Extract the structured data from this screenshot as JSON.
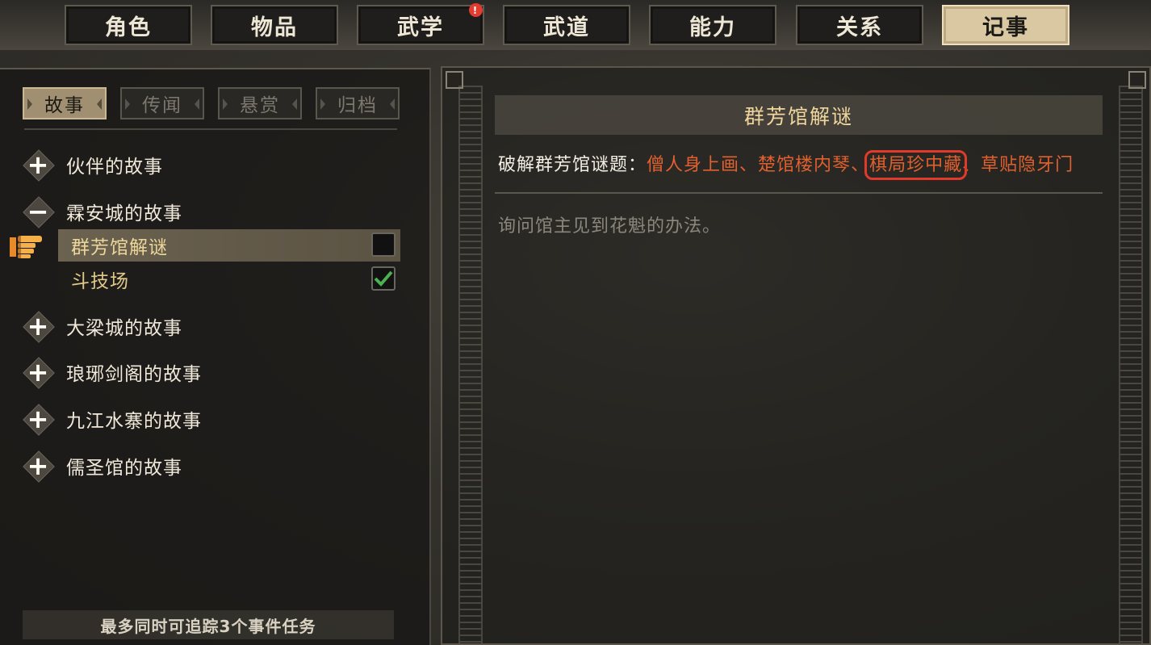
{
  "top_tabs": [
    {
      "label": "角色"
    },
    {
      "label": "物品"
    },
    {
      "label": "武学",
      "badge": "!"
    },
    {
      "label": "武道"
    },
    {
      "label": "能力"
    },
    {
      "label": "关系"
    },
    {
      "label": "记事",
      "active": true
    }
  ],
  "sub_tabs": [
    {
      "label": "故事",
      "active": true
    },
    {
      "label": "传闻"
    },
    {
      "label": "悬赏"
    },
    {
      "label": "归档"
    }
  ],
  "story_tree": {
    "groups": [
      {
        "label": "伙伴的故事",
        "expanded": false,
        "icon": "+"
      },
      {
        "label": "霖安城的故事",
        "expanded": true,
        "icon": "−"
      },
      {
        "label": "大梁城的故事",
        "expanded": false,
        "icon": "+"
      },
      {
        "label": "琅琊剑阁的故事",
        "expanded": false,
        "icon": "+"
      },
      {
        "label": "九江水寨的故事",
        "expanded": false,
        "icon": "+"
      },
      {
        "label": "儒圣馆的故事",
        "expanded": false,
        "icon": "+"
      }
    ],
    "sub_items": [
      {
        "label": "群芳馆解谜",
        "selected": true,
        "tracked": false
      },
      {
        "label": "斗技场",
        "selected": false,
        "tracked": true
      }
    ]
  },
  "footer_note": "最多同时可追踪3个事件任务",
  "quest": {
    "title": "群芳馆解谜",
    "goal_prefix": "破解群芳馆谜题：",
    "goal_items": [
      "僧人身上画",
      "楚馆楼内琴",
      "棋局珍中藏",
      "草贴隐牙门"
    ],
    "goal_separator": "、",
    "description": "询问馆主见到花魁的办法。"
  },
  "colors": {
    "accent_gold": "#f0d69d",
    "goal_orange": "#e0602f",
    "highlight_red": "#e23a2a",
    "check_green": "#4caf50"
  }
}
